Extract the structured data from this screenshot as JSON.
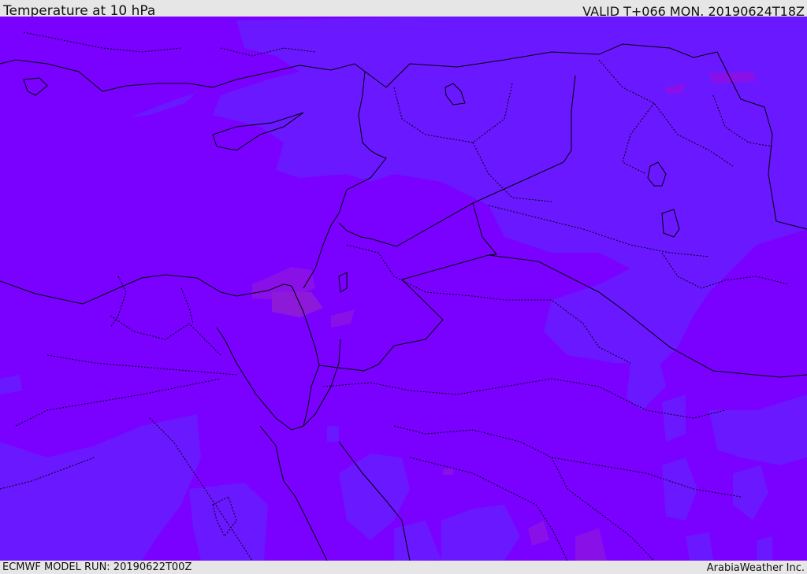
{
  "header": {
    "title": "Temperature at 10 hPa",
    "valid": "VALID T+066 MON. 20190624T18Z"
  },
  "footer": {
    "model_run": "ECMWF MODEL RUN: 20190622T00Z",
    "credit": "ArabiaWeather Inc."
  },
  "map": {
    "colors": {
      "background_field": "#7a00ff",
      "cooler_field": "#6a18ff",
      "warmer_field": "#8a10e8",
      "border_line": "#000000"
    }
  }
}
